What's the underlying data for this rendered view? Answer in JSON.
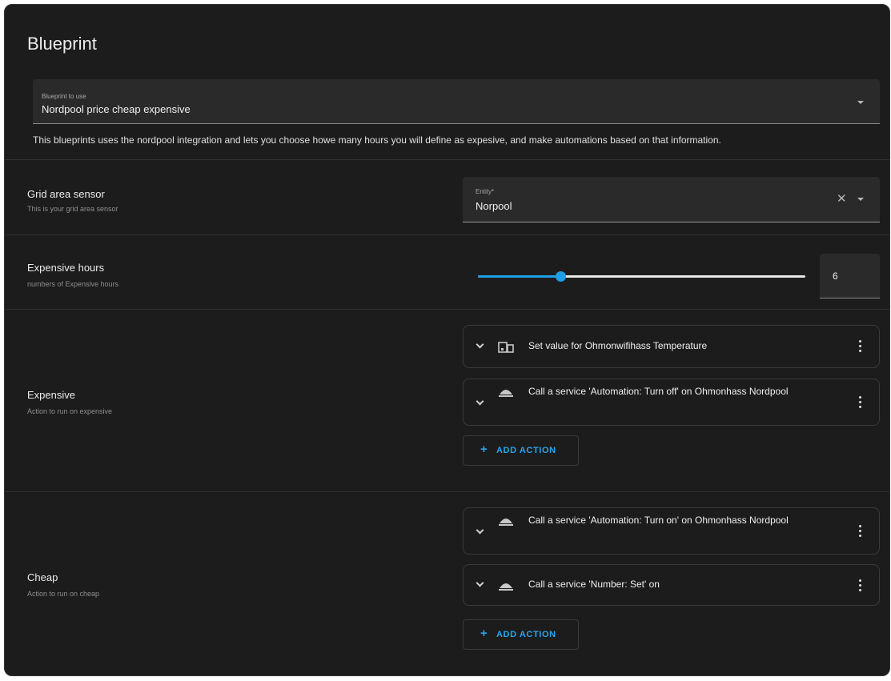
{
  "card": {
    "title": "Blueprint"
  },
  "blueprint_select": {
    "label": "Blueprint to use",
    "value": "Nordpool price cheap expensive",
    "description": "This blueprints uses the nordpool integration and lets you choose howe many hours you will define as expesive, and make automations based on that information."
  },
  "grid_area": {
    "title": "Grid area sensor",
    "subtitle": "This is your grid area sensor",
    "field_label": "Entity*",
    "field_value": "Norpool"
  },
  "expensive_hours": {
    "title": "Expensive hours",
    "subtitle": "numbers of Expensive hours",
    "value": "6",
    "slider_fraction": 0.253
  },
  "expensive": {
    "title": "Expensive",
    "subtitle": "Action to run on expensive",
    "actions": [
      {
        "icon": "device-icon",
        "text": "Set value for Ohmonwifihass Temperature"
      },
      {
        "icon": "service-icon",
        "text": "Call a service 'Automation: Turn off' on Ohmonhass Nordpool"
      }
    ],
    "add_label": "ADD ACTION"
  },
  "cheap": {
    "title": "Cheap",
    "subtitle": "Action to run on cheap",
    "actions": [
      {
        "icon": "service-icon",
        "text": "Call a service 'Automation: Turn on' on Ohmonhass Nordpool"
      },
      {
        "icon": "service-icon",
        "text": "Call a service 'Number: Set' on"
      }
    ],
    "add_label": "ADD ACTION"
  },
  "colors": {
    "background": "#1c1c1c",
    "field": "#2a2a2a",
    "accent": "#1f9ee8",
    "button_text": "#2ea3ec"
  }
}
